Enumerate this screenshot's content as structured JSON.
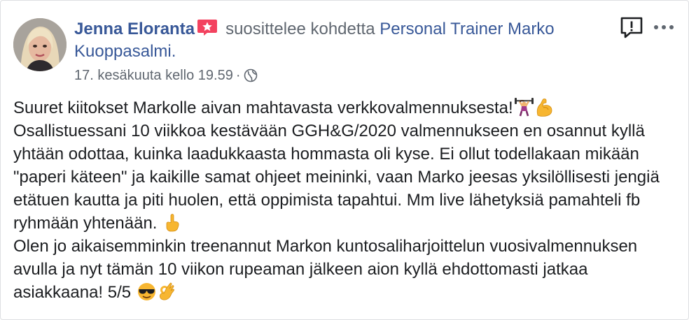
{
  "post": {
    "author": "Jenna Eloranta",
    "verb": "suosittelee kohdetta",
    "page": "Personal Trainer Marko Kuoppasalmi.",
    "timestamp": "17. kesäkuuta kello 19.59",
    "separator": "·",
    "privacy_icon": "globe-icon",
    "recommendation_icon": "star-badge-icon",
    "report_icon": "report-exclamation-icon",
    "more_icon": "more-dots-icon",
    "paragraphs": [
      "Suuret kiitokset Markolle aivan mahtavasta verkkovalmennuksesta!",
      "Osallistuessani 10 viikkoa kestävään GGH&G/2020 valmennukseen en osannut kyllä yhtään odottaa, kuinka laadukkaasta hommasta oli kyse. Ei ollut todellakaan mikään \"paperi käteen\" ja kaikille samat ohjeet meininki, vaan Marko jeesas yksilöllisesti jengiä etätuen kautta ja piti huolen, että oppimista tapahtui. Mm live lähetyksiä pamahteli fb ryhmään yhtenään.",
      "Olen jo aikaisemminkin treenannut Markon kuntosaliharjoittelun vuosivalmennuksen avulla ja nyt tämän 10 viikon rupeaman jälkeen aion kyllä ehdottomasti jatkaa asiakkaana! 5/5"
    ],
    "emojis": {
      "p1": [
        "weightlifter-emoji",
        "flexed-biceps-emoji"
      ],
      "p2": [
        "pointing-up-emoji"
      ],
      "p3": [
        "sunglasses-face-emoji",
        "ok-hand-emoji"
      ]
    },
    "colors": {
      "link": "#385898",
      "secondary": "#606770",
      "text": "#1c1e21",
      "badge": "#f3425f"
    }
  }
}
